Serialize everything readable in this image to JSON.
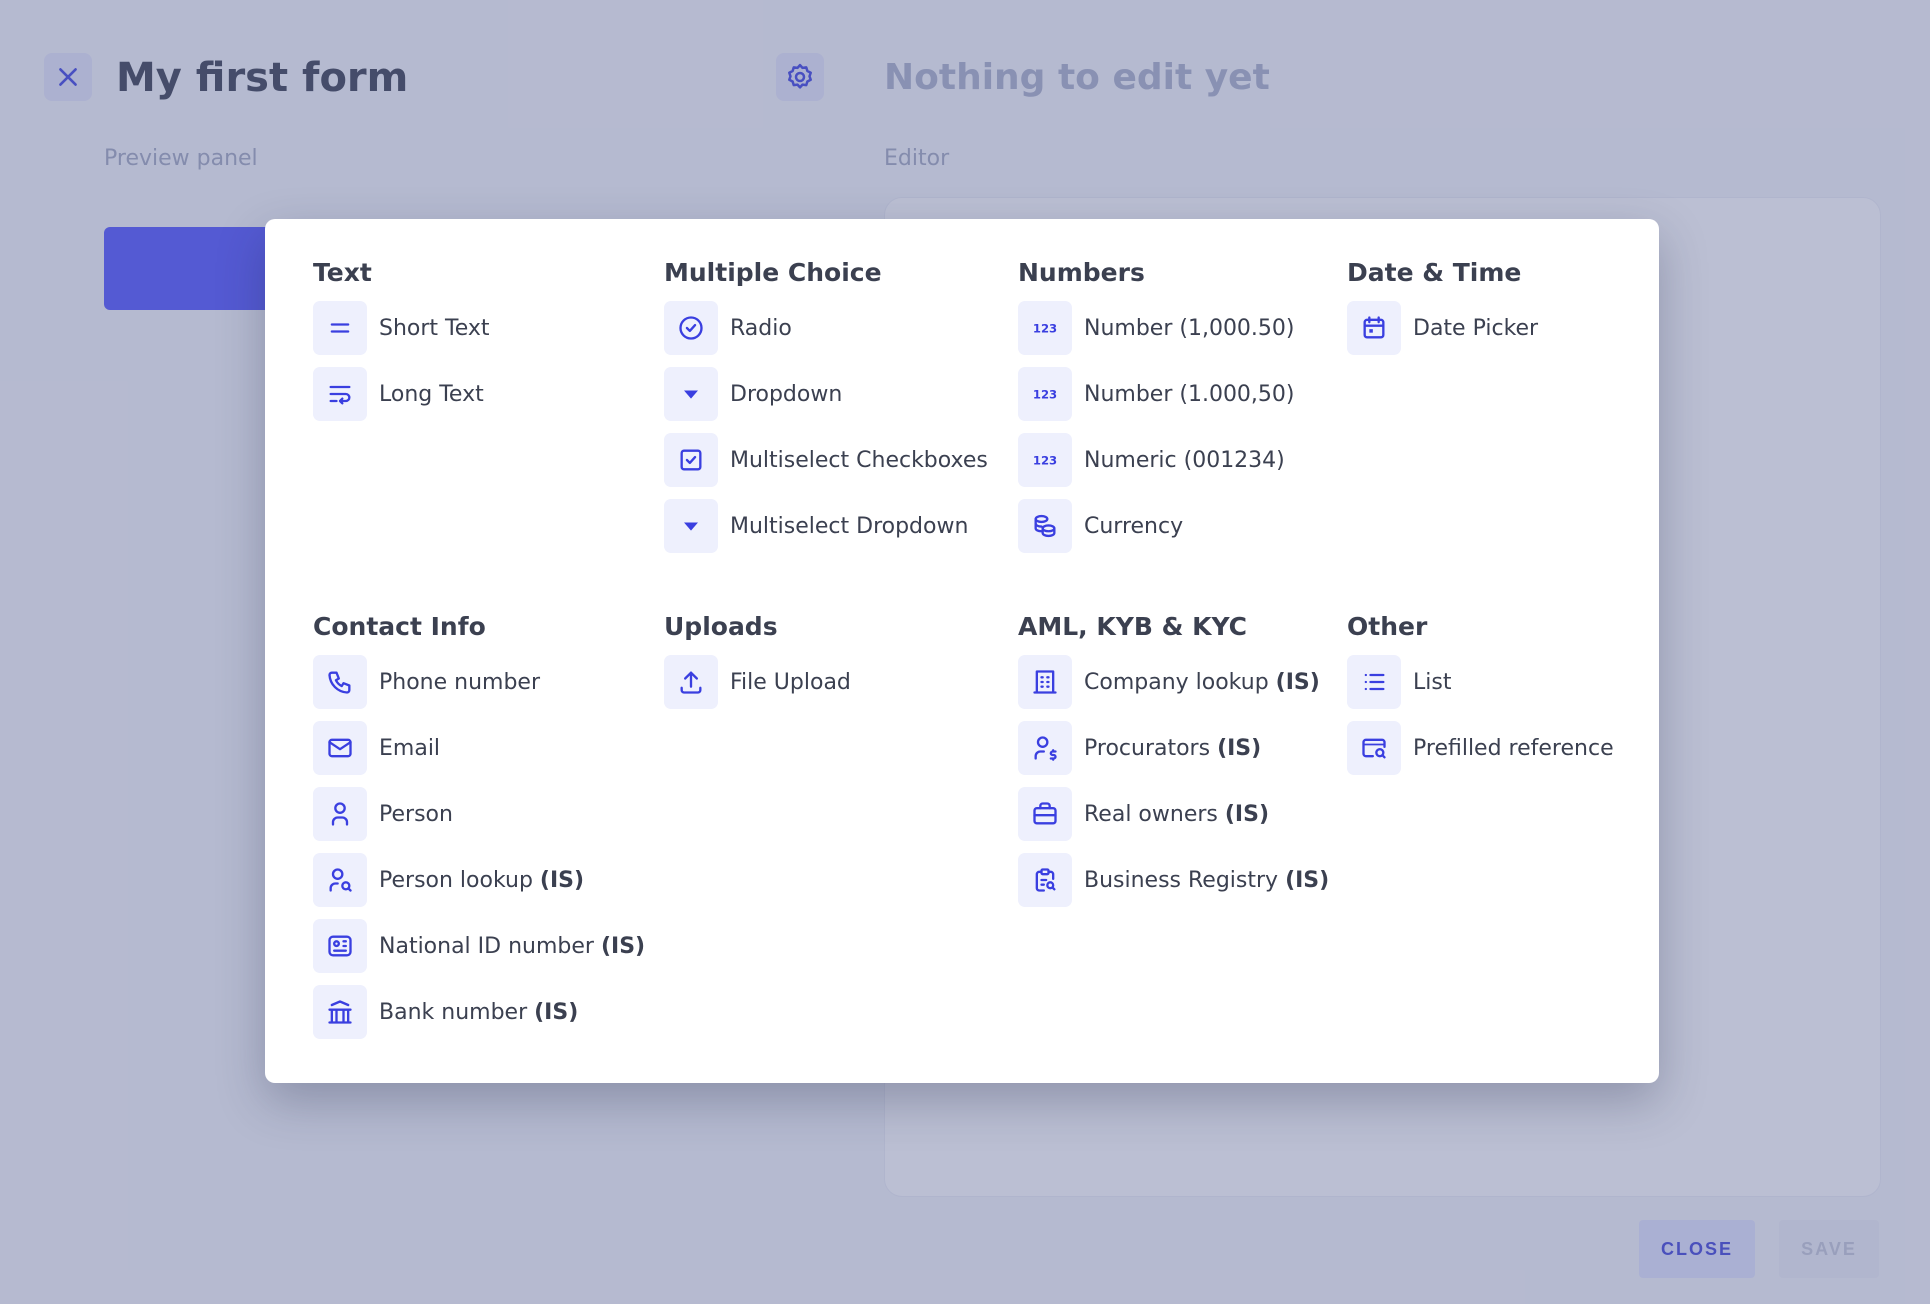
{
  "header": {
    "title": "My first form",
    "editor_title": "Nothing to edit yet"
  },
  "panels": {
    "preview": "Preview panel",
    "editor": "Editor"
  },
  "footer": {
    "close": "CLOSE",
    "save": "SAVE"
  },
  "colors": {
    "accent": "#3a3fe0",
    "icon_bg": "#eef0fd",
    "overlay": "#5e6796"
  },
  "sections": [
    {
      "title": "Text",
      "items": [
        {
          "label": "Short Text",
          "suffix": "",
          "icon": "equals-icon"
        },
        {
          "label": "Long Text",
          "suffix": "",
          "icon": "text-wrap-icon"
        }
      ]
    },
    {
      "title": "Multiple Choice",
      "items": [
        {
          "label": "Radio",
          "suffix": "",
          "icon": "radio-check-icon"
        },
        {
          "label": "Dropdown",
          "suffix": "",
          "icon": "caret-down-icon"
        },
        {
          "label": "Multiselect Checkboxes",
          "suffix": "",
          "icon": "checkbox-icon"
        },
        {
          "label": "Multiselect Dropdown",
          "suffix": "",
          "icon": "caret-down-icon"
        }
      ]
    },
    {
      "title": "Numbers",
      "items": [
        {
          "label": "Number (1,000.50)",
          "suffix": "",
          "icon": "numbers-123-icon"
        },
        {
          "label": "Number (1.000,50)",
          "suffix": "",
          "icon": "numbers-123-icon"
        },
        {
          "label": "Numeric (001234)",
          "suffix": "",
          "icon": "numbers-123-icon"
        },
        {
          "label": "Currency",
          "suffix": "",
          "icon": "coins-icon"
        }
      ]
    },
    {
      "title": "Date & Time",
      "items": [
        {
          "label": "Date Picker",
          "suffix": "",
          "icon": "calendar-icon"
        }
      ]
    },
    {
      "title": "Contact Info",
      "items": [
        {
          "label": "Phone number",
          "suffix": "",
          "icon": "phone-icon"
        },
        {
          "label": "Email",
          "suffix": "",
          "icon": "mail-icon"
        },
        {
          "label": "Person",
          "suffix": "",
          "icon": "person-icon"
        },
        {
          "label": "Person lookup ",
          "suffix": "(IS)",
          "icon": "person-search-icon"
        },
        {
          "label": "National ID number ",
          "suffix": "(IS)",
          "icon": "id-card-icon"
        },
        {
          "label": "Bank number ",
          "suffix": "(IS)",
          "icon": "bank-icon"
        }
      ]
    },
    {
      "title": "Uploads",
      "items": [
        {
          "label": "File Upload",
          "suffix": "",
          "icon": "upload-icon"
        }
      ]
    },
    {
      "title": "AML, KYB & KYC",
      "items": [
        {
          "label": "Company lookup ",
          "suffix": "(IS)",
          "icon": "building-icon"
        },
        {
          "label": "Procurators ",
          "suffix": "(IS)",
          "icon": "person-dollar-icon"
        },
        {
          "label": "Real owners ",
          "suffix": "(IS)",
          "icon": "briefcase-icon"
        },
        {
          "label": "Business Registry ",
          "suffix": "(IS)",
          "icon": "clipboard-search-icon"
        }
      ]
    },
    {
      "title": "Other",
      "items": [
        {
          "label": "List",
          "suffix": "",
          "icon": "list-icon"
        },
        {
          "label": "Prefilled reference",
          "suffix": "",
          "icon": "window-search-icon"
        }
      ]
    }
  ]
}
